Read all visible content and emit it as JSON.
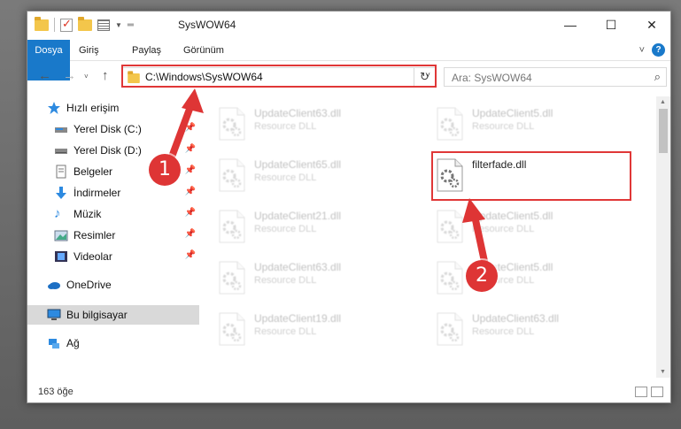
{
  "window": {
    "title": "SysWOW64"
  },
  "ribbon": {
    "tabs": [
      {
        "label": "Dosya"
      },
      {
        "label": "Giriş"
      },
      {
        "label": "Paylaş"
      },
      {
        "label": "Görünüm"
      }
    ]
  },
  "nav": {
    "address": "C:\\Windows\\SysWOW64",
    "search_placeholder": "Ara: SysWOW64"
  },
  "sidebar": {
    "items": [
      {
        "label": "Hızlı erişim",
        "icon": "star-icon"
      },
      {
        "label": "Yerel Disk (C:)",
        "icon": "drive-icon",
        "pinned": true
      },
      {
        "label": "Yerel Disk (D:)",
        "icon": "drive-icon",
        "pinned": true
      },
      {
        "label": "Belgeler",
        "icon": "documents-icon",
        "pinned": true
      },
      {
        "label": "İndirmeler",
        "icon": "download-icon",
        "pinned": true
      },
      {
        "label": "Müzik",
        "icon": "music-icon",
        "pinned": true
      },
      {
        "label": "Resimler",
        "icon": "pictures-icon",
        "pinned": true
      },
      {
        "label": "Videolar",
        "icon": "video-icon",
        "pinned": true
      },
      {
        "label": "OneDrive",
        "icon": "cloud-icon"
      },
      {
        "label": "Bu bilgisayar",
        "icon": "computer-icon",
        "selected": true
      },
      {
        "label": "Ağ",
        "icon": "network-icon"
      }
    ]
  },
  "files": [
    {
      "name": "UpdateClient63.dll",
      "type": "Resource DLL"
    },
    {
      "name": "UpdateClient5.dll",
      "type": "Resource DLL"
    },
    {
      "name": "UpdateClient65.dll",
      "type": "Resource DLL"
    },
    {
      "name": "filterfade.dll",
      "type": ""
    },
    {
      "name": "UpdateClient21.dll",
      "type": "Resource DLL"
    },
    {
      "name": "UpdateClient5.dll",
      "type": "Resource DLL"
    },
    {
      "name": "UpdateClient63.dll",
      "type": "Resource DLL"
    },
    {
      "name": "UpdateClient5.dll",
      "type": "Resource DLL"
    },
    {
      "name": "UpdateClient19.dll",
      "type": "Resource DLL"
    },
    {
      "name": "UpdateClient63.dll",
      "type": "Resource DLL"
    }
  ],
  "status": {
    "item_count": "163 öğe"
  },
  "callouts": {
    "one": "1",
    "two": "2"
  },
  "colors": {
    "accent": "#1979ca",
    "annotation": "#de3535"
  }
}
